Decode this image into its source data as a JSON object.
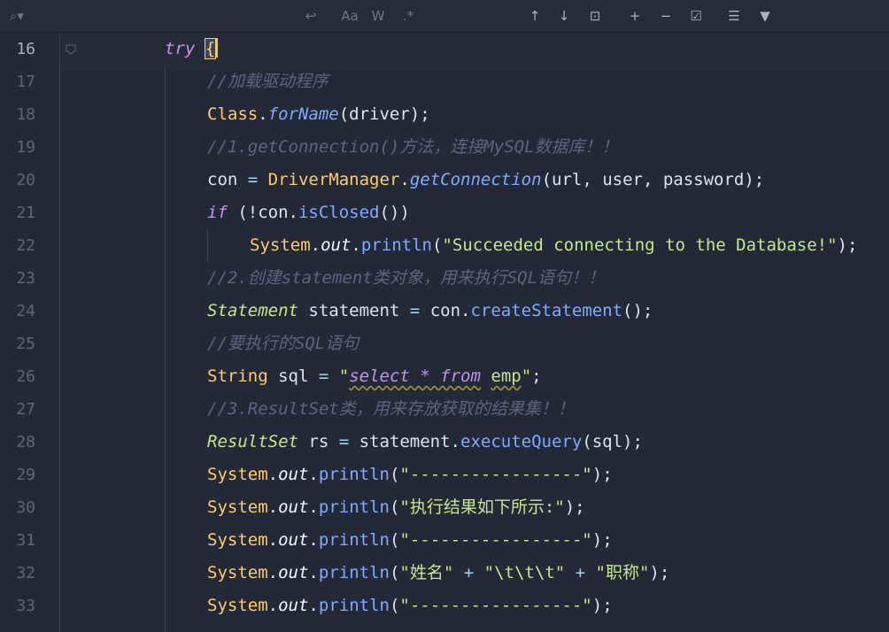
{
  "toolbar": {
    "items": [
      {
        "name": "search-options-icon",
        "glyph": "⌕▾"
      },
      {
        "name": "regex-wrap-icon",
        "glyph": "↩"
      },
      {
        "name": "match-case-toggle",
        "glyph": "Aa"
      },
      {
        "name": "words-toggle",
        "glyph": "W"
      },
      {
        "name": "regex-toggle",
        "glyph": ".*"
      },
      {
        "name": "previous-occurrence-icon",
        "glyph": "↑"
      },
      {
        "name": "next-occurrence-icon",
        "glyph": "↓"
      },
      {
        "name": "open-in-window-icon",
        "glyph": "⊡"
      },
      {
        "name": "add-occurrence-icon",
        "glyph": "+"
      },
      {
        "name": "remove-occurrence-icon",
        "glyph": "−"
      },
      {
        "name": "select-all-occurrences-icon",
        "glyph": "☑"
      },
      {
        "name": "filter-settings-icon",
        "glyph": "☰"
      },
      {
        "name": "filter-icon",
        "glyph": "▼"
      }
    ]
  },
  "editor": {
    "line_numbers": [
      "16",
      "17",
      "18",
      "19",
      "20",
      "21",
      "22",
      "23",
      "24",
      "25",
      "26",
      "27",
      "28",
      "29",
      "30",
      "31",
      "32",
      "33"
    ],
    "current_line": "16",
    "lines": [
      [
        [
          "kw",
          "try"
        ],
        [
          "p",
          " "
        ],
        [
          "brace",
          "{"
        ]
      ],
      [
        [
          "cm",
          "//加载驱动程序"
        ]
      ],
      [
        [
          "cls",
          "Class"
        ],
        [
          "p",
          "."
        ],
        [
          "mthi",
          "forName"
        ],
        [
          "p",
          "(driver);"
        ]
      ],
      [
        [
          "cm",
          "//1.getConnection()方法，连接MySQL数据库！！"
        ]
      ],
      [
        [
          "p",
          "con "
        ],
        [
          "op",
          "="
        ],
        [
          "p",
          " "
        ],
        [
          "cls",
          "DriverManager"
        ],
        [
          "p",
          "."
        ],
        [
          "mthi",
          "getConnection"
        ],
        [
          "p",
          "(url, user, password);"
        ]
      ],
      [
        [
          "kw",
          "if"
        ],
        [
          "p",
          " (!con."
        ],
        [
          "mth",
          "isClosed"
        ],
        [
          "p",
          "())"
        ]
      ],
      [
        [
          "cls",
          "System"
        ],
        [
          "p",
          "."
        ],
        [
          "fld",
          "out"
        ],
        [
          "p",
          "."
        ],
        [
          "mth",
          "println"
        ],
        [
          "p",
          "("
        ],
        [
          "str",
          "\"Succeeded connecting to the Database!\""
        ],
        [
          "p",
          ");"
        ]
      ],
      [
        [
          "cm",
          "//2.创建statement类对象，用来执行SQL语句！！"
        ]
      ],
      [
        [
          "cli",
          "Statement"
        ],
        [
          "p",
          " statement "
        ],
        [
          "op",
          "="
        ],
        [
          "p",
          " con."
        ],
        [
          "mth",
          "createStatement"
        ],
        [
          "p",
          "();"
        ]
      ],
      [
        [
          "cm",
          "//要执行的SQL语句"
        ]
      ],
      [
        [
          "cls",
          "String"
        ],
        [
          "p",
          " sql "
        ],
        [
          "op",
          "="
        ],
        [
          "p",
          " "
        ],
        [
          "str",
          "\""
        ],
        [
          "sqlkw",
          "select * from"
        ],
        [
          "p",
          " "
        ],
        [
          "sqlt",
          "emp"
        ],
        [
          "str",
          "\""
        ],
        [
          "p",
          ";"
        ]
      ],
      [
        [
          "cm",
          "//3.ResultSet类，用来存放获取的结果集！！"
        ]
      ],
      [
        [
          "cli",
          "ResultSet"
        ],
        [
          "p",
          " rs "
        ],
        [
          "op",
          "="
        ],
        [
          "p",
          " statement."
        ],
        [
          "mth",
          "executeQuery"
        ],
        [
          "p",
          "(sql);"
        ]
      ],
      [
        [
          "cls",
          "System"
        ],
        [
          "p",
          "."
        ],
        [
          "fld",
          "out"
        ],
        [
          "p",
          "."
        ],
        [
          "mth",
          "println"
        ],
        [
          "p",
          "("
        ],
        [
          "str",
          "\"-----------------\""
        ],
        [
          "p",
          ");"
        ]
      ],
      [
        [
          "cls",
          "System"
        ],
        [
          "p",
          "."
        ],
        [
          "fld",
          "out"
        ],
        [
          "p",
          "."
        ],
        [
          "mth",
          "println"
        ],
        [
          "p",
          "("
        ],
        [
          "str",
          "\"执行结果如下所示:\""
        ],
        [
          "p",
          ");"
        ]
      ],
      [
        [
          "cls",
          "System"
        ],
        [
          "p",
          "."
        ],
        [
          "fld",
          "out"
        ],
        [
          "p",
          "."
        ],
        [
          "mth",
          "println"
        ],
        [
          "p",
          "("
        ],
        [
          "str",
          "\"-----------------\""
        ],
        [
          "p",
          ");"
        ]
      ],
      [
        [
          "cls",
          "System"
        ],
        [
          "p",
          "."
        ],
        [
          "fld",
          "out"
        ],
        [
          "p",
          "."
        ],
        [
          "mth",
          "println"
        ],
        [
          "p",
          "("
        ],
        [
          "str",
          "\"姓名\""
        ],
        [
          "p",
          " "
        ],
        [
          "op",
          "+"
        ],
        [
          "p",
          " "
        ],
        [
          "str",
          "\"\\t\\t\\t\""
        ],
        [
          "p",
          " "
        ],
        [
          "op",
          "+"
        ],
        [
          "p",
          " "
        ],
        [
          "str",
          "\"职称\""
        ],
        [
          "p",
          ");"
        ]
      ],
      [
        [
          "cls",
          "System"
        ],
        [
          "p",
          "."
        ],
        [
          "fld",
          "out"
        ],
        [
          "p",
          "."
        ],
        [
          "mth",
          "println"
        ],
        [
          "p",
          "("
        ],
        [
          "str",
          "\"-----------------\""
        ],
        [
          "p",
          ");"
        ]
      ]
    ]
  },
  "colors": {
    "background": "#232936",
    "keyword": "#c792ea",
    "comment": "#5c6580",
    "class": "#ffcb6b",
    "method": "#82aaff",
    "string": "#c3e88d",
    "caret": "#ffcc00"
  }
}
